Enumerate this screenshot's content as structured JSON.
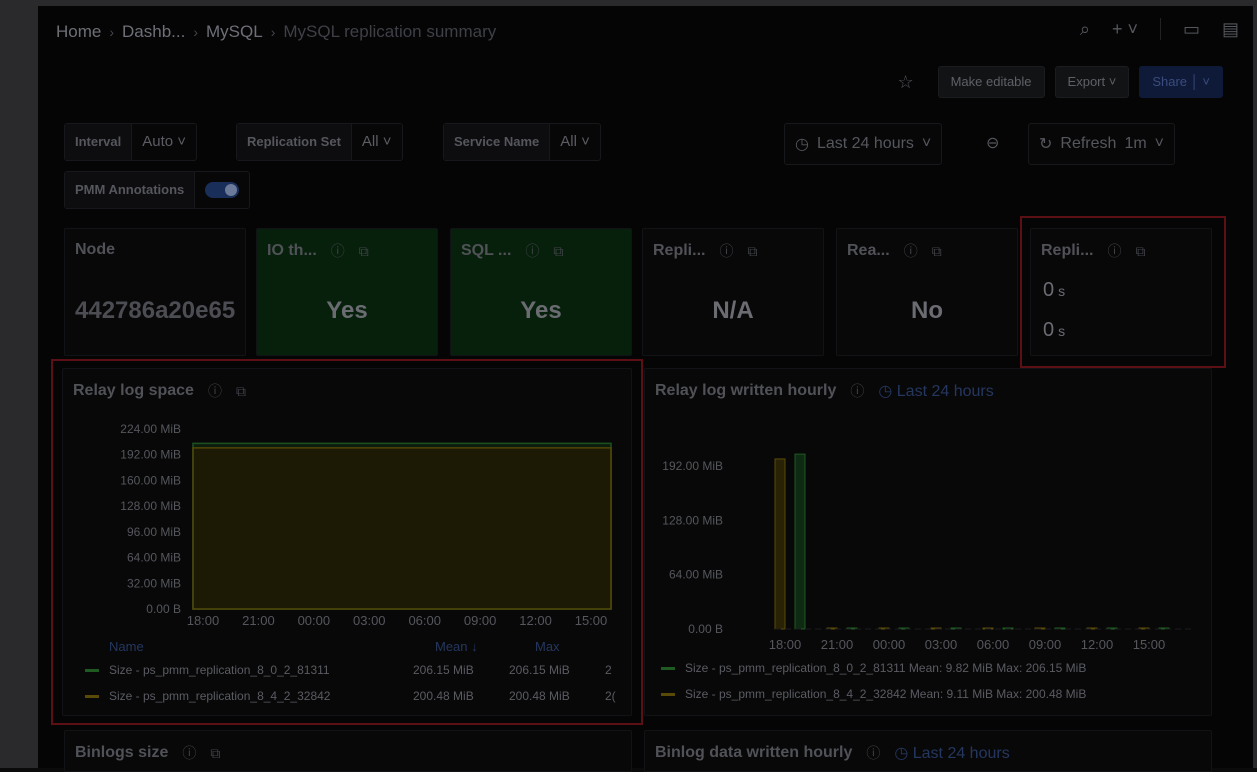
{
  "breadcrumb": [
    "Home",
    "Dashb...",
    "MySQL",
    "MySQL replication summary"
  ],
  "header_actions": {
    "make_editable": "Make editable",
    "export": "Export",
    "share": "Share"
  },
  "variables": [
    {
      "label": "Interval",
      "value": "Auto"
    },
    {
      "label": "Replication Set",
      "value": "All"
    },
    {
      "label": "Service Name",
      "value": "All"
    }
  ],
  "annotations_toggle": {
    "label": "PMM Annotations",
    "on": true
  },
  "time_range": "Last 24 hours",
  "refresh": {
    "label": "Refresh",
    "interval": "1m"
  },
  "stats": {
    "node": {
      "title": "Node",
      "value": "442786a20e65"
    },
    "io_thread": {
      "title": "IO th...",
      "value": "Yes"
    },
    "sql_thread": {
      "title": "SQL ...",
      "value": "Yes"
    },
    "replication_error": {
      "title": "Repli...",
      "value": "N/A"
    },
    "read_only": {
      "title": "Rea...",
      "value": "No"
    },
    "replication_lag": {
      "title": "Repli...",
      "value1": "0",
      "value2": "0",
      "unit": "s"
    }
  },
  "relay_log_space": {
    "title": "Relay log space",
    "y_ticks": [
      "224.00 MiB",
      "192.00 MiB",
      "160.00 MiB",
      "128.00 MiB",
      "96.00 MiB",
      "64.00 MiB",
      "32.00 MiB",
      "0.00 B"
    ],
    "x_ticks": [
      "18:00",
      "21:00",
      "00:00",
      "03:00",
      "06:00",
      "09:00",
      "12:00",
      "15:00"
    ],
    "legend_headers": {
      "name": "Name",
      "mean": "Mean ↓",
      "max": "Max"
    },
    "legend": [
      {
        "name": "Size - ps_pmm_replication_8_0_2_81311",
        "mean": "206.15 MiB",
        "max": "206.15 MiB",
        "extra": "2",
        "color": "#1f5a22"
      },
      {
        "name": "Size - ps_pmm_replication_8_4_2_32842",
        "mean": "200.48 MiB",
        "max": "200.48 MiB",
        "extra": "2(",
        "color": "#5a4a08"
      }
    ]
  },
  "relay_log_written": {
    "title": "Relay log written hourly",
    "time_link": "Last 24 hours",
    "y_ticks": [
      "192.00 MiB",
      "128.00 MiB",
      "64.00 MiB",
      "0.00 B"
    ],
    "x_ticks": [
      "18:00",
      "21:00",
      "00:00",
      "03:00",
      "06:00",
      "09:00",
      "12:00",
      "15:00"
    ],
    "legend": [
      {
        "text": "Size - ps_pmm_replication_8_0_2_81311  Mean: 9.82 MiB  Max: 206.15 MiB",
        "color": "#1f5a22"
      },
      {
        "text": "Size - ps_pmm_replication_8_4_2_32842  Mean: 9.11 MiB  Max: 200.48 MiB",
        "color": "#5a4a08"
      }
    ]
  },
  "binlogs_size": {
    "title": "Binlogs size"
  },
  "binlog_written": {
    "title": "Binlog data written hourly",
    "time_link": "Last 24 hours"
  },
  "chart_data": [
    {
      "type": "area",
      "title": "Relay log space",
      "x": [
        "18:00",
        "21:00",
        "00:00",
        "03:00",
        "06:00",
        "09:00",
        "12:00",
        "15:00"
      ],
      "ylim": [
        0,
        224
      ],
      "series": [
        {
          "name": "Size - ps_pmm_replication_8_0_2_81311",
          "values": [
            206.15,
            206.15,
            206.15,
            206.15,
            206.15,
            206.15,
            206.15,
            206.15
          ]
        },
        {
          "name": "Size - ps_pmm_replication_8_4_2_32842",
          "values": [
            200.48,
            200.48,
            200.48,
            200.48,
            200.48,
            200.48,
            200.48,
            200.48
          ]
        }
      ]
    },
    {
      "type": "bar",
      "title": "Relay log written hourly",
      "categories": [
        "18:00",
        "21:00",
        "00:00",
        "03:00",
        "06:00",
        "09:00",
        "12:00",
        "15:00"
      ],
      "ylim": [
        0,
        224
      ],
      "series": [
        {
          "name": "Size - ps_pmm_replication_8_0_2_81311",
          "values": [
            206.15,
            0,
            0,
            0,
            0,
            0,
            0,
            0
          ]
        },
        {
          "name": "Size - ps_pmm_replication_8_4_2_32842",
          "values": [
            200.48,
            0,
            0,
            0,
            0,
            0,
            0,
            0
          ]
        }
      ]
    }
  ]
}
